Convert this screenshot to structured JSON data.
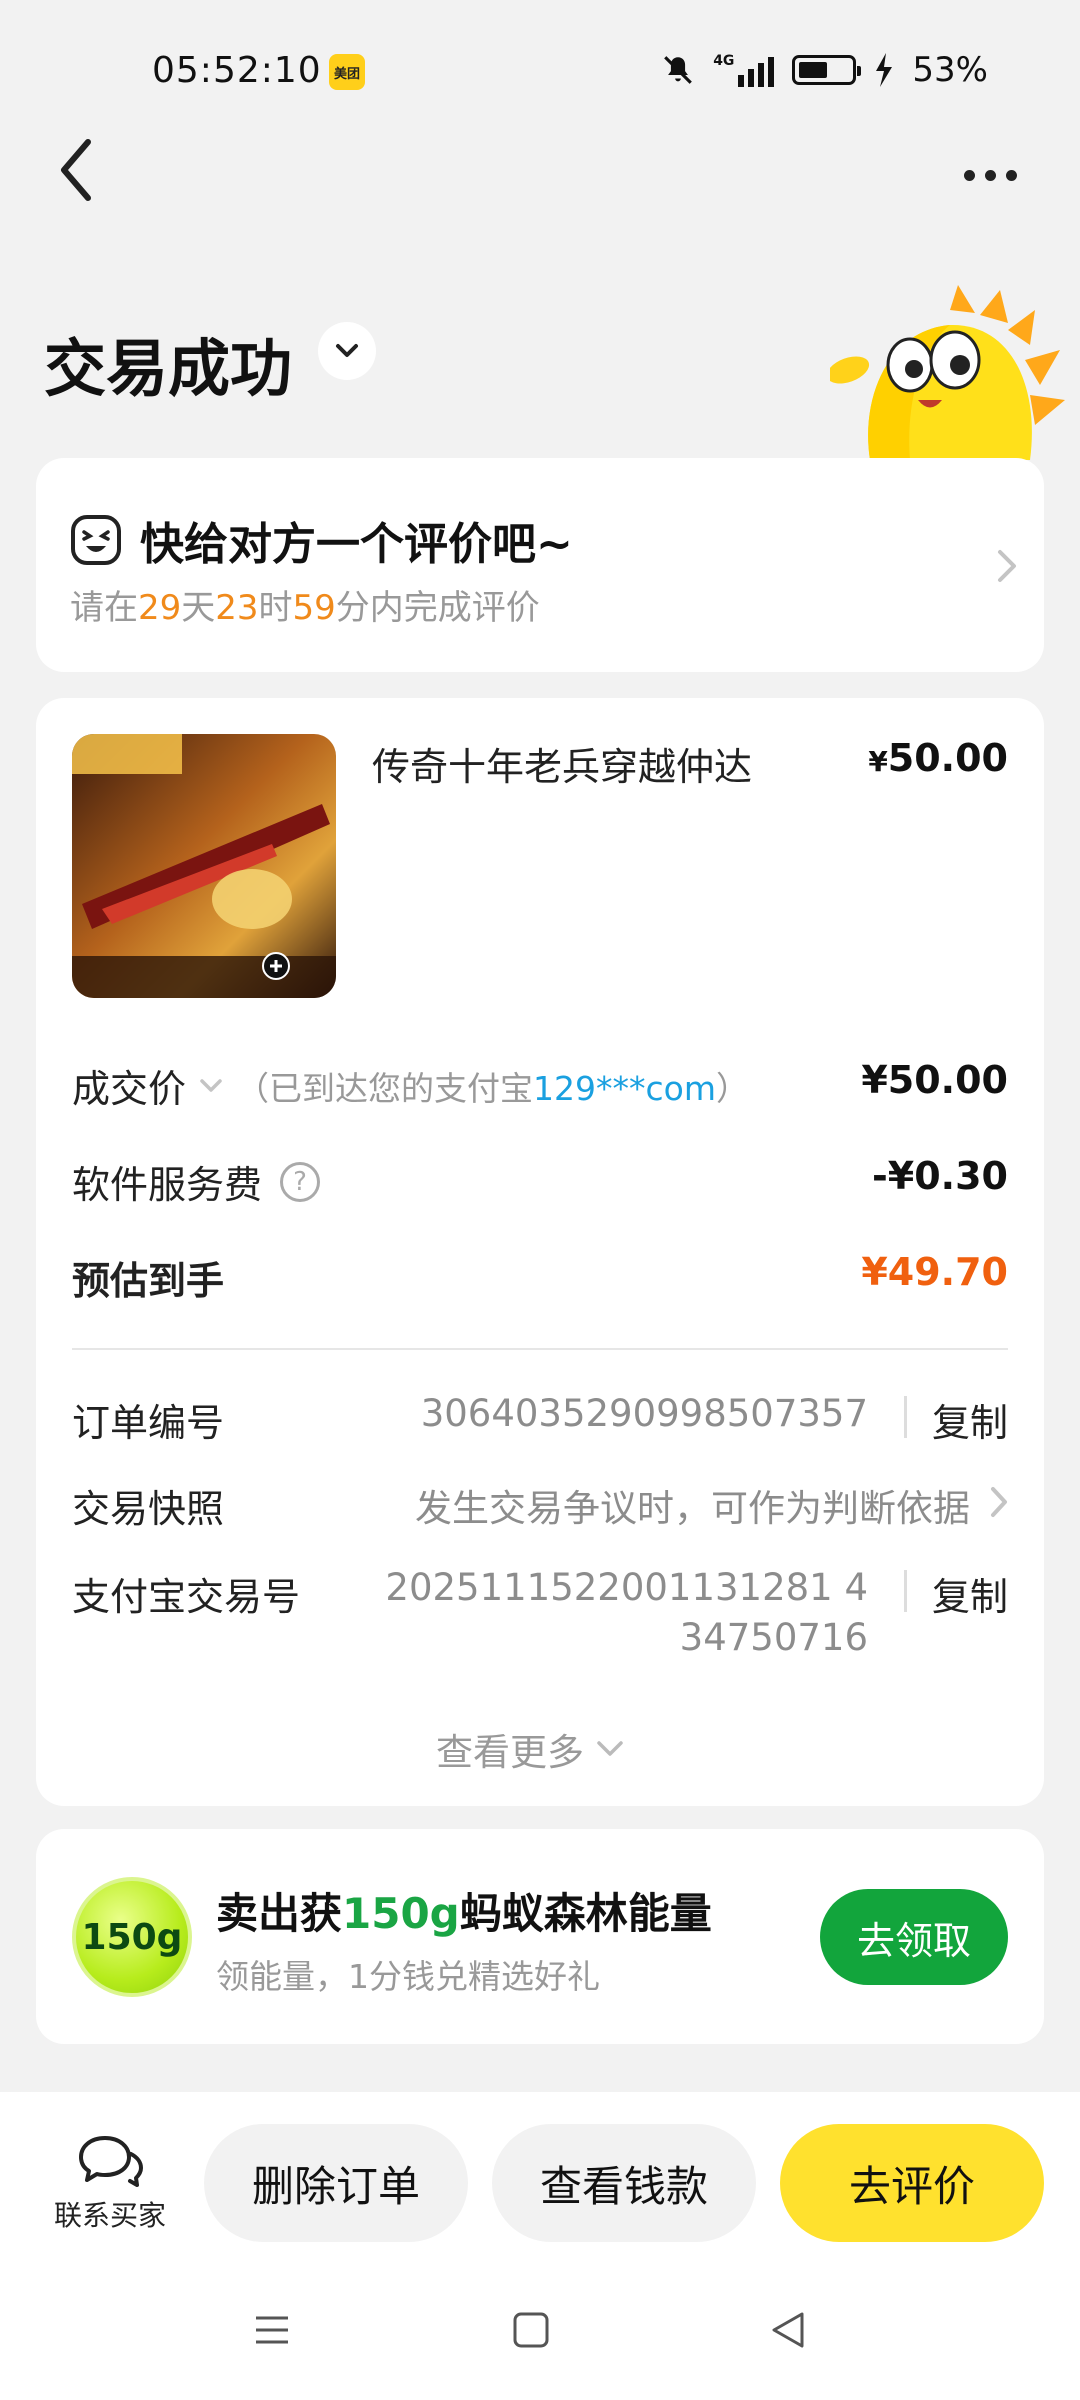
{
  "status_bar": {
    "time": "05:52:10",
    "app_badge": "美团",
    "network": "4G",
    "battery_percent": "53%",
    "battery_level": 0.53
  },
  "header": {
    "title": "交易成功"
  },
  "review_card": {
    "title": "快给对方一个评价吧~",
    "countdown_prefix": "请在",
    "days": "29",
    "days_unit": "天",
    "hours": "23",
    "hours_unit": "时",
    "minutes": "59",
    "countdown_suffix": "分内完成评价"
  },
  "product": {
    "title": "传奇十年老兵穿越仲达",
    "price_symbol": "¥",
    "price": "50.00"
  },
  "pricing": {
    "deal_label": "成交价",
    "deal_note_prefix": "（已到达您的支付宝",
    "deal_note_account": "129***com",
    "deal_note_suffix": "）",
    "deal_value": "¥50.00",
    "fee_label": "软件服务费",
    "fee_value": "-¥0.30",
    "estimate_label": "预估到手",
    "estimate_value": "¥49.70",
    "estimate_color": "#f0600f"
  },
  "order_meta": {
    "order_no_label": "订单编号",
    "order_no": "3064035290998507357",
    "copy_label": "复制",
    "snapshot_label": "交易快照",
    "snapshot_hint": "发生交易争议时，可作为判断依据",
    "alipay_no_label": "支付宝交易号",
    "alipay_no_line1": "2025111522001131281 4",
    "alipay_no_line2": "34750716",
    "alipay_copy_label": "复制",
    "see_more": "查看更多"
  },
  "energy": {
    "badge": "150g",
    "title_prefix": "卖出获",
    "title_highlight": "150g",
    "title_suffix": "蚂蚁森林能量",
    "subtitle": "领能量，1分钱兑精选好礼",
    "button": "去领取"
  },
  "bottom_bar": {
    "contact_label": "联系买家",
    "delete_label": "删除订单",
    "view_money_label": "查看钱款",
    "review_label": "去评价"
  },
  "icons": {
    "back": "back-arrow-icon",
    "more": "more-dots-icon",
    "emoji": "smile-emoji-icon",
    "chat": "chat-bubbles-icon"
  },
  "colors": {
    "accent_yellow": "#ffe12e",
    "highlight_orange": "#f08a1b",
    "link_blue": "#1aa0e0",
    "energy_green": "#12a53c"
  }
}
